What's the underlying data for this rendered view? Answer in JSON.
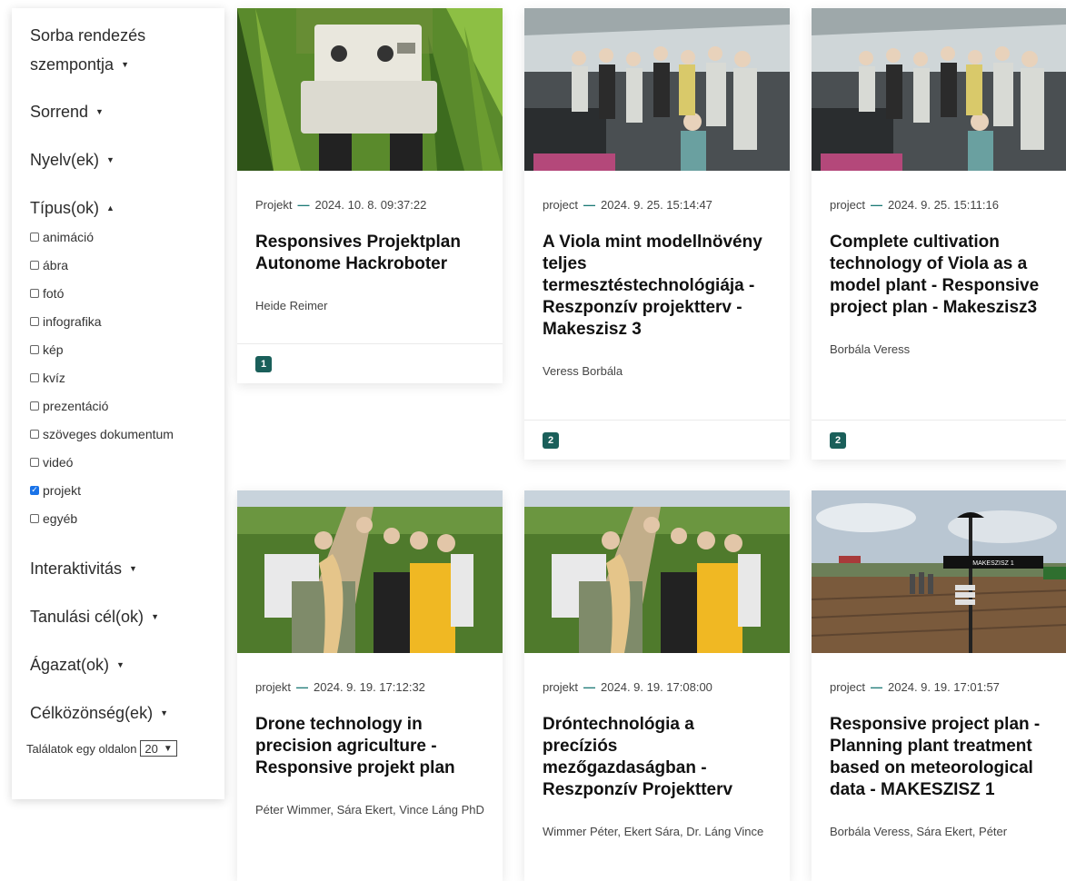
{
  "sidebar": {
    "sort_by": "Sorba rendezés szempontja",
    "order": "Sorrend",
    "language": "Nyelv(ek)",
    "type": "Típus(ok)",
    "type_options": [
      {
        "label": "animáció",
        "checked": false
      },
      {
        "label": "ábra",
        "checked": false
      },
      {
        "label": "fotó",
        "checked": false
      },
      {
        "label": "infografika",
        "checked": false
      },
      {
        "label": "kép",
        "checked": false
      },
      {
        "label": "kvíz",
        "checked": false
      },
      {
        "label": "prezentáció",
        "checked": false
      },
      {
        "label": "szöveges dokumentum",
        "checked": false
      },
      {
        "label": "videó",
        "checked": false
      },
      {
        "label": "projekt",
        "checked": true
      },
      {
        "label": "egyéb",
        "checked": false
      }
    ],
    "interactivity": "Interaktivitás",
    "learning_goals": "Tanulási cél(ok)",
    "sector": "Ágazat(ok)",
    "audience": "Célközönség(ek)",
    "per_page_label": "Találatok egy oldalon",
    "per_page_value": "20"
  },
  "cards": [
    {
      "type": "Projekt",
      "date": "2024. 10. 8. 09:37:22",
      "title": "Responsives Projektplan Autonome Hackroboter",
      "author": "Heide Reimer",
      "badge": "1",
      "image": "robot-in-cornfield"
    },
    {
      "type": "project",
      "date": "2024. 9. 25. 15:14:47",
      "title": "A Viola mint modellnövény teljes termesztéstechnológiája - Reszponzív projektterv - Makeszisz 3",
      "author": "Veress Borbála",
      "badge": "2",
      "image": "group-in-greenhouse"
    },
    {
      "type": "project",
      "date": "2024. 9. 25. 15:11:16",
      "title": "Complete cultivation technology of Viola as a model plant - Responsive project plan - Makeszisz3",
      "author": "Borbála Veress",
      "badge": "2",
      "image": "group-in-greenhouse"
    },
    {
      "type": "projekt",
      "date": "2024. 9. 19. 17:12:32",
      "title": "Drone technology in precision agriculture - Responsive projekt plan",
      "author": "Péter Wimmer, Sára Ekert, Vince Láng PhD",
      "image": "students-in-field"
    },
    {
      "type": "projekt",
      "date": "2024. 9. 19. 17:08:00",
      "title": "Dróntechnológia a precíziós mezőgazdaságban - Reszponzív Projektterv",
      "author": "Wimmer Péter, Ekert Sára, Dr. Láng Vince",
      "image": "students-in-field"
    },
    {
      "type": "project",
      "date": "2024. 9. 19. 17:01:57",
      "title": "Responsive project plan - Planning plant treatment based on meteorological data - MAKESZISZ 1",
      "author": "Borbála Veress, Sára Ekert, Péter",
      "image": "weather-station-field",
      "image_sign": "MAKESZISZ 1"
    }
  ]
}
